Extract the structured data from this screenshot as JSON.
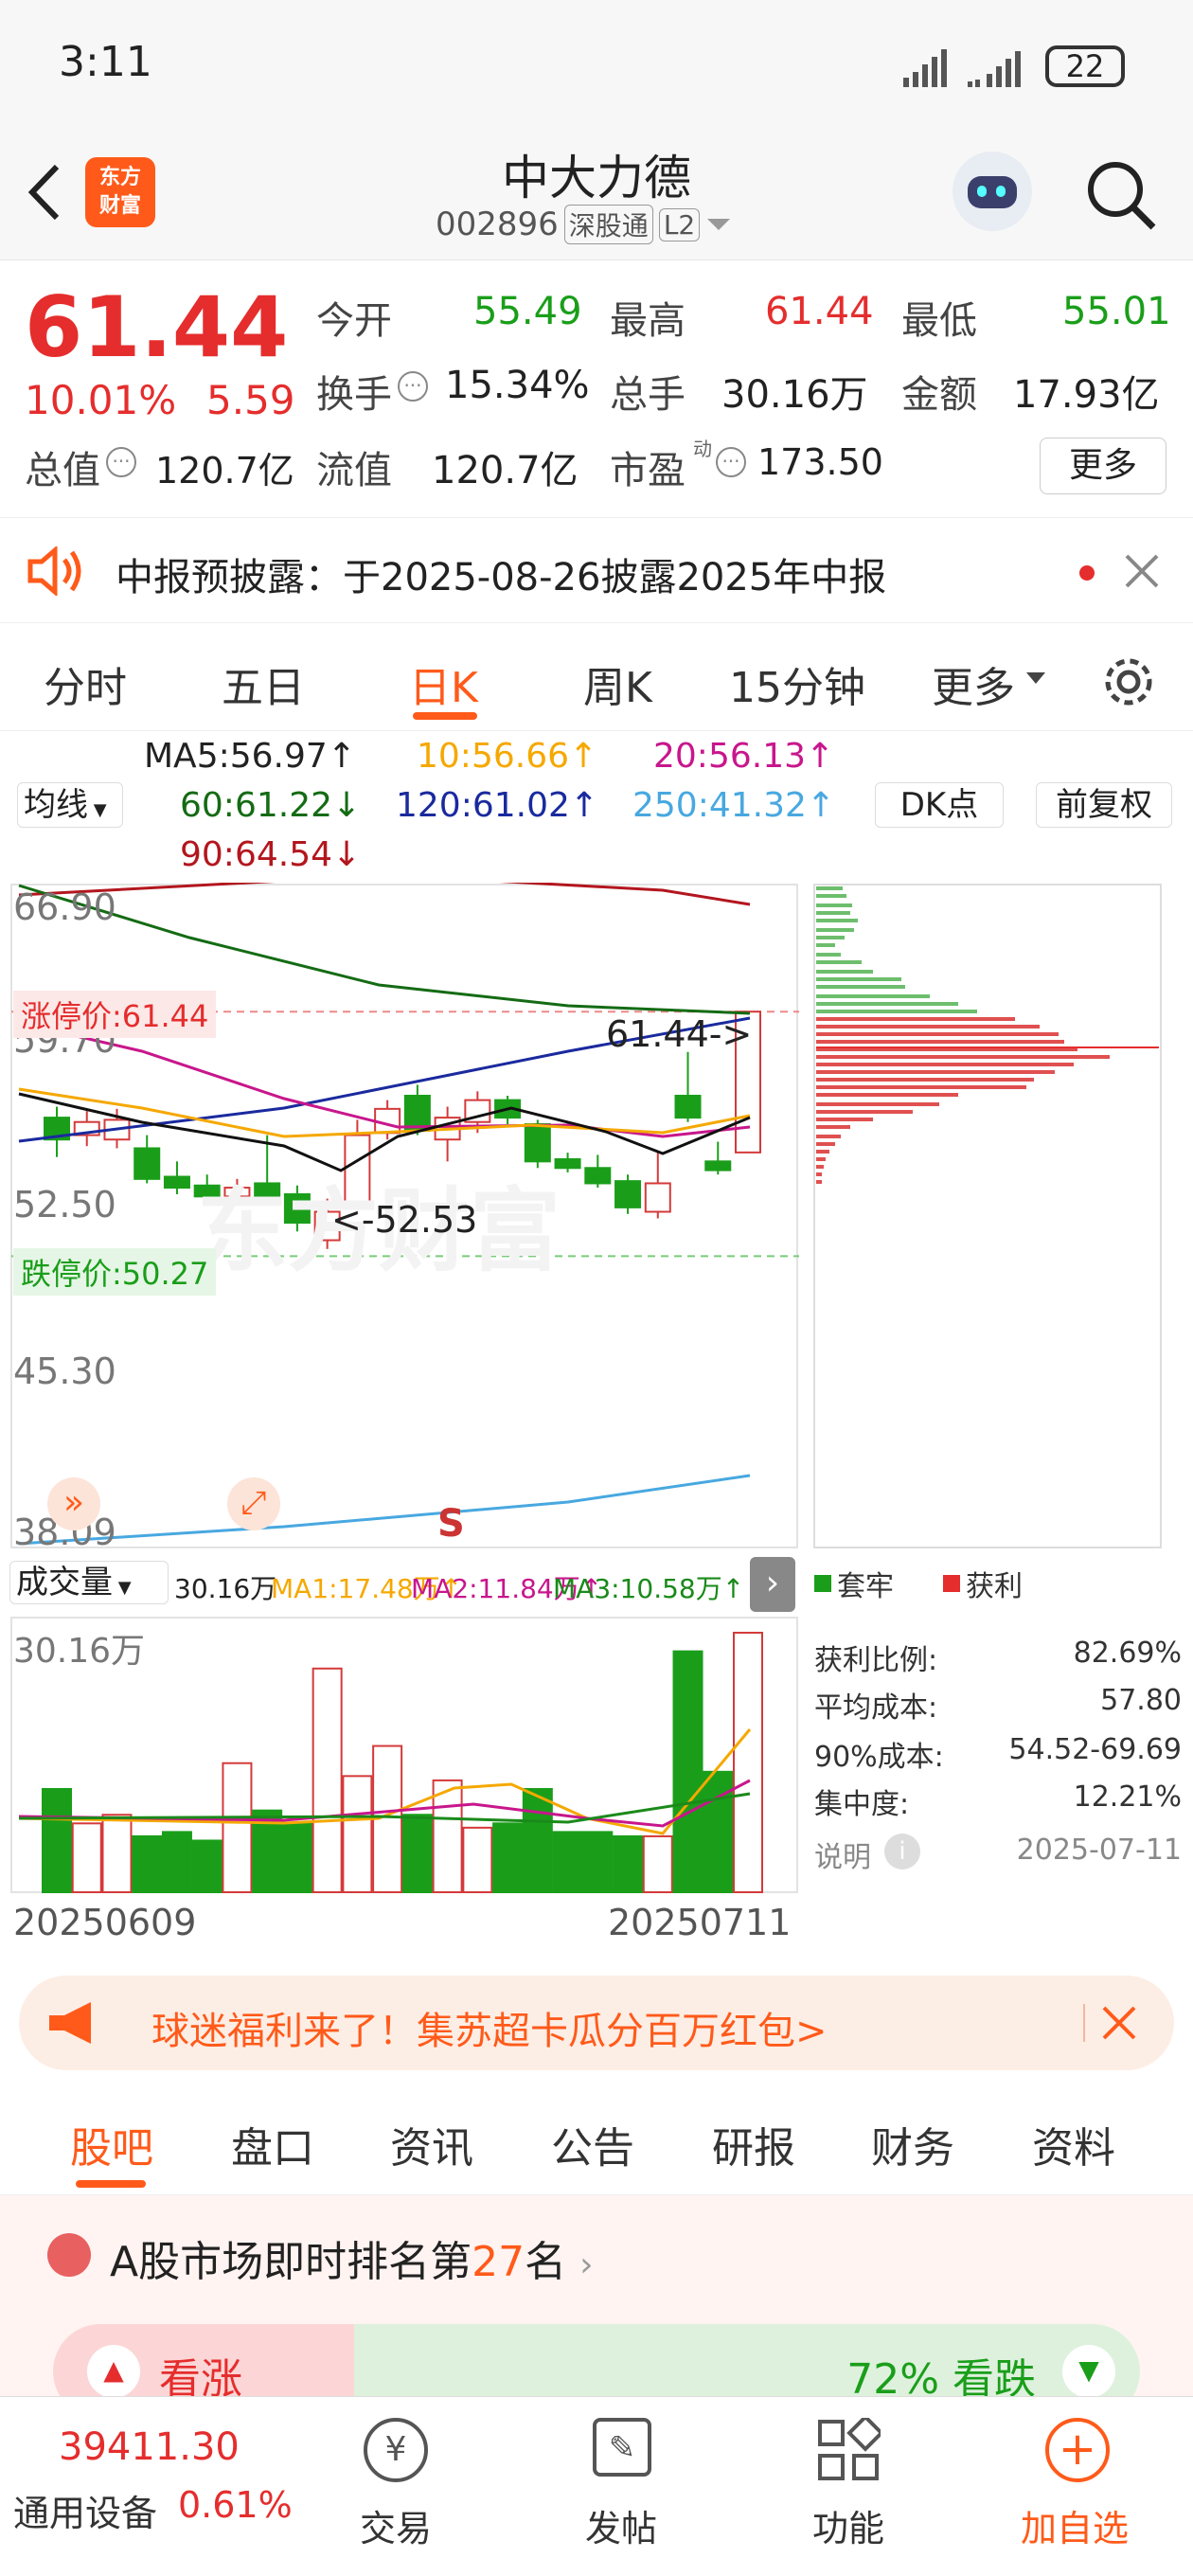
{
  "status": {
    "time": "3:11",
    "battery": "22"
  },
  "header": {
    "back": "<",
    "logo": "东方\n财富",
    "name": "中大力德",
    "code": "002896",
    "market_tag": "深股通",
    "level_tag": "L2"
  },
  "quote": {
    "price": "61.44",
    "pct": "10.01%",
    "chg": "5.59",
    "fields": [
      {
        "label": "今开",
        "value": "55.49",
        "color": "green"
      },
      {
        "label": "最高",
        "value": "61.44",
        "color": "red"
      },
      {
        "label": "最低",
        "value": "55.01",
        "color": "green"
      },
      {
        "label": "换手",
        "value": "15.34%",
        "color": "dark"
      },
      {
        "label": "总手",
        "value": "30.16万",
        "color": "dark"
      },
      {
        "label": "金额",
        "value": "17.93亿",
        "color": "dark"
      }
    ],
    "mktcap_label": "总值",
    "mktcap": "120.7亿",
    "float_label": "流值",
    "float": "120.7亿",
    "pe_label": "市盈",
    "pe_sup": "动",
    "pe": "173.50",
    "more": "更多"
  },
  "notice": {
    "text": "中报预披露：于2025-08-26披露2025年中报"
  },
  "chart_tabs": [
    "分时",
    "五日",
    "日K",
    "周K",
    "15分钟",
    "更多"
  ],
  "active_tab": "日K",
  "ma": {
    "selector": "均线",
    "ma5": "MA5:56.97↑",
    "ma10": "10:56.66↑",
    "ma20": "20:56.13↑",
    "ma60": "60:61.22↓",
    "ma120": "120:61.02↑",
    "ma250": "250:41.32↑",
    "ma90": "90:64.54↓",
    "dk": "DK点",
    "adjust": "前复权"
  },
  "kline": {
    "y_ticks": [
      "66.90",
      "59.70",
      "52.50",
      "45.30",
      "38.09"
    ],
    "limit_up": "涨停价:61.44",
    "limit_down": "跌停价:50.27",
    "high_label": "61.44->",
    "low_label": "<-52.53",
    "signal": "S"
  },
  "volume": {
    "selector": "成交量",
    "vol": "30.16万",
    "ma1": "MA1:17.48万↑",
    "ma2": "MA2:11.84万↑",
    "ma3": "MA3:10.58万↑",
    "y_top": "30.16万",
    "date_start": "20250609",
    "date_end": "20250711"
  },
  "chips": {
    "legend_trapped": "套牢",
    "legend_profit": "获利",
    "rows": [
      {
        "label": "获利比例:",
        "value": "82.69%"
      },
      {
        "label": "平均成本:",
        "value": "57.80"
      },
      {
        "label": "90%成本:",
        "value": "54.52-69.69"
      },
      {
        "label": "集中度:",
        "value": "12.21%"
      }
    ],
    "note": "说明",
    "date": "2025-07-11"
  },
  "chart_data": {
    "type": "candlestick",
    "x": [
      "20250609",
      "20250711"
    ],
    "candles": [
      {
        "o": 56.6,
        "c": 55.6,
        "h": 57.1,
        "l": 54.8
      },
      {
        "o": 55.8,
        "c": 56.4,
        "h": 56.9,
        "l": 55.3
      },
      {
        "o": 55.6,
        "c": 56.5,
        "h": 57.0,
        "l": 55.2
      },
      {
        "o": 55.2,
        "c": 53.8,
        "h": 55.8,
        "l": 53.6
      },
      {
        "o": 53.9,
        "c": 53.4,
        "h": 54.6,
        "l": 53.1
      },
      {
        "o": 53.5,
        "c": 53.0,
        "h": 54.0,
        "l": 52.8
      },
      {
        "o": 53.0,
        "c": 53.4,
        "h": 53.8,
        "l": 52.7
      },
      {
        "o": 53.6,
        "c": 53.0,
        "h": 55.8,
        "l": 52.9
      },
      {
        "o": 53.1,
        "c": 51.8,
        "h": 53.5,
        "l": 51.4
      },
      {
        "o": 51.0,
        "c": 52.3,
        "h": 52.9,
        "l": 50.6
      },
      {
        "o": 52.6,
        "c": 55.8,
        "h": 56.5,
        "l": 52.53
      },
      {
        "o": 55.9,
        "c": 57.0,
        "h": 57.4,
        "l": 55.6
      },
      {
        "o": 57.6,
        "c": 56.0,
        "h": 58.1,
        "l": 55.8
      },
      {
        "o": 55.6,
        "c": 56.6,
        "h": 57.1,
        "l": 54.6
      },
      {
        "o": 56.4,
        "c": 57.4,
        "h": 57.8,
        "l": 55.9
      },
      {
        "o": 57.4,
        "c": 56.6,
        "h": 57.6,
        "l": 56.3
      },
      {
        "o": 56.3,
        "c": 54.6,
        "h": 56.5,
        "l": 54.3
      },
      {
        "o": 54.7,
        "c": 54.3,
        "h": 55.0,
        "l": 54.1
      },
      {
        "o": 54.3,
        "c": 53.6,
        "h": 54.9,
        "l": 53.4
      },
      {
        "o": 53.7,
        "c": 52.5,
        "h": 54.0,
        "l": 52.2
      },
      {
        "o": 52.3,
        "c": 53.6,
        "h": 55.0,
        "l": 52.0
      },
      {
        "o": 57.6,
        "c": 56.6,
        "h": 59.6,
        "l": 56.4
      },
      {
        "o": 54.6,
        "c": 54.2,
        "h": 55.5,
        "l": 54.0
      },
      {
        "o": 55.01,
        "c": 61.44,
        "h": 61.44,
        "l": 55.01
      }
    ],
    "volume": [
      12,
      8,
      9,
      6.5,
      7,
      6,
      15,
      9.5,
      8,
      26,
      13.5,
      17,
      9,
      13,
      7.5,
      8,
      12,
      7,
      7,
      6.5,
      6.5,
      28,
      14,
      30.16
    ],
    "ma5": [
      56.0,
      55.8,
      55.4,
      55.0,
      54.7,
      54.2,
      53.8,
      53.4,
      53.1,
      53.4,
      53.9,
      54.6,
      55.2,
      55.7,
      56.0,
      56.4,
      56.2,
      55.8,
      55.4,
      54.9,
      54.6,
      54.9,
      55.3,
      56.97
    ],
    "ylim": [
      38.09,
      66.9
    ]
  },
  "banner": {
    "text": "球迷福利来了！集苏超卡瓜分百万红包>"
  },
  "lower_tabs": [
    "股吧",
    "盘口",
    "资讯",
    "公告",
    "研报",
    "财务",
    "资料"
  ],
  "rank": {
    "prefix": "A股市场即时排名第",
    "num": "27",
    "suffix": "名"
  },
  "vote": {
    "up": "看涨",
    "down": "72% 看跌"
  },
  "bottom": {
    "index_value": "39411.30",
    "index_name": "通用设备",
    "index_pct": "0.61%",
    "items": [
      "交易",
      "发帖",
      "功能",
      "加自选"
    ]
  }
}
